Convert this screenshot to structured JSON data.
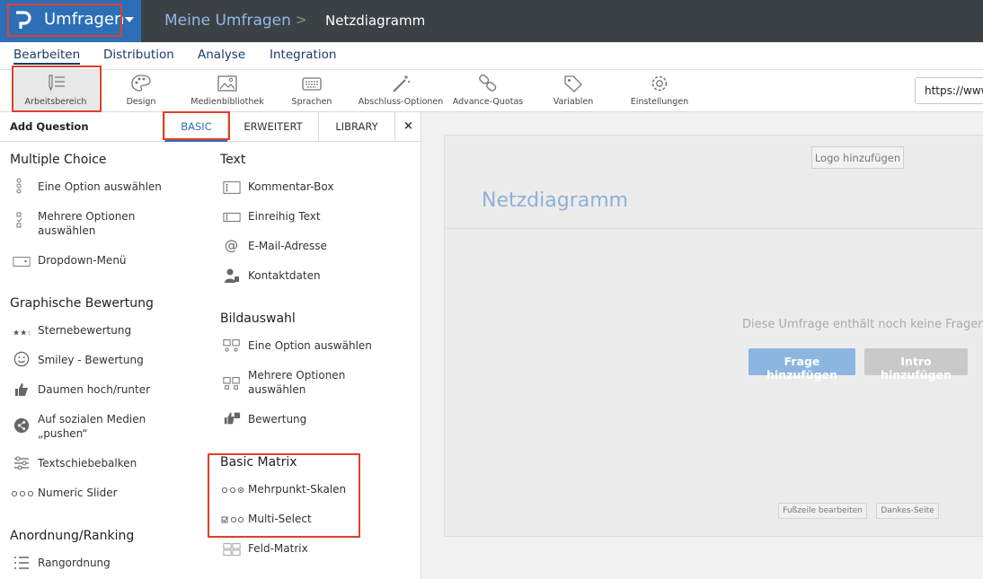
{
  "topbar": {
    "app_name": "Umfragen",
    "breadcrumb_parent": "Meine Umfragen",
    "breadcrumb_separator": ">",
    "breadcrumb_current": "Netzdiagramm"
  },
  "nav": {
    "items": [
      "Bearbeiten",
      "Distribution",
      "Analyse",
      "Integration"
    ],
    "active": "Bearbeiten"
  },
  "toolbar": {
    "tools": [
      {
        "label": "Arbeitsbereich",
        "icon": "pencil-list-icon"
      },
      {
        "label": "Design",
        "icon": "palette-icon"
      },
      {
        "label": "Medienbibliothek",
        "icon": "image-icon"
      },
      {
        "label": "Sprachen",
        "icon": "keyboard-icon"
      },
      {
        "label": "Abschluss-Optionen",
        "icon": "magic-wand-icon"
      },
      {
        "label": "Advance-Quotas",
        "icon": "link-icon"
      },
      {
        "label": "Variablen",
        "icon": "tag-icon"
      },
      {
        "label": "Einstellungen",
        "icon": "gear-icon"
      }
    ],
    "url_value": "https://www"
  },
  "panel": {
    "title": "Add Question",
    "tabs": [
      "BASIC",
      "ERWEITERT",
      "LIBRARY"
    ],
    "active_tab": "BASIC",
    "close": "×",
    "left_sections": [
      {
        "heading": "Multiple Choice",
        "items": [
          "Eine Option auswählen",
          "Mehrere Optionen auswählen",
          "Dropdown-Menü"
        ]
      },
      {
        "heading": "Graphische Bewertung",
        "items": [
          "Sternebewertung",
          "Smiley - Bewertung",
          "Daumen hoch/runter",
          "Auf sozialen Medien „pushen“",
          "Textschiebebalken",
          "Numeric Slider"
        ]
      },
      {
        "heading": "Anordnung/Ranking",
        "items": [
          "Rangordnung"
        ]
      }
    ],
    "right_sections": [
      {
        "heading": "Text",
        "items": [
          "Kommentar-Box",
          "Einreihig Text",
          "E-Mail-Adresse",
          "Kontaktdaten"
        ]
      },
      {
        "heading": "Bildauswahl",
        "items": [
          "Eine Option auswählen",
          "Mehrere Optionen auswählen",
          "Bewertung"
        ]
      },
      {
        "heading": "Basic Matrix",
        "items": [
          "Mehrpunkt-Skalen",
          "Multi-Select",
          "Feld-Matrix"
        ]
      }
    ]
  },
  "canvas": {
    "logo_button": "Logo hinzufügen",
    "survey_title": "Netzdiagramm",
    "empty_message": "Diese Umfrage enthält noch keine Fragen",
    "add_question_button": "Frage hinzufügen",
    "add_intro_button": "Intro hinzufügen",
    "footer_button": "Fußzeile bearbeiten",
    "thanks_button": "Dankes-Seite"
  },
  "colors": {
    "topbar": "#3c4146",
    "brand_blue": "#2c6fb7",
    "highlight": "#e0402a"
  }
}
